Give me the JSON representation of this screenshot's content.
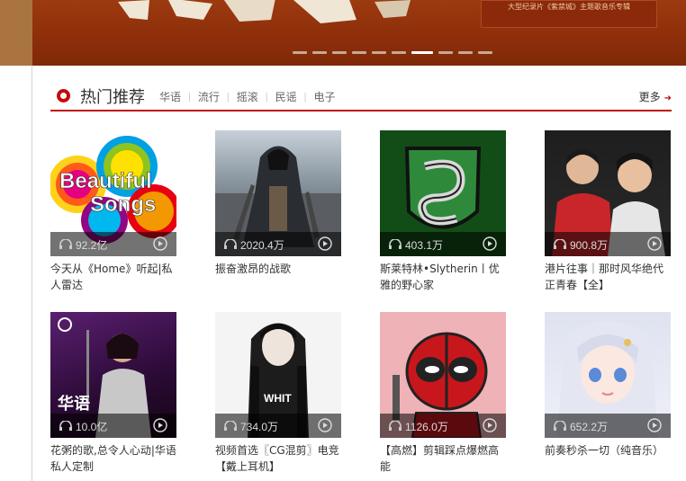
{
  "banner": {
    "tag_text": "大型纪录片《紫禁城》主题歌音乐专辑",
    "slide_count": 10,
    "active_slide": 7
  },
  "section": {
    "title": "热门推荐",
    "tags": [
      "华语",
      "流行",
      "摇滚",
      "民谣",
      "电子"
    ],
    "more": "更多"
  },
  "playlists": [
    {
      "count": "92.2亿",
      "title": "今天从《Home》听起|私人雷达",
      "cover_text": "Beautiful Songs"
    },
    {
      "count": "2020.4万",
      "title": "振奋激昂的战歌",
      "cover_text": ""
    },
    {
      "count": "403.1万",
      "title": "斯莱特林•Slytherin丨优雅的野心家",
      "cover_text": ""
    },
    {
      "count": "900.8万",
      "title": "港片往事｜那时风华绝代正青春【全】",
      "cover_text": ""
    },
    {
      "count": "10.0亿",
      "title": "花粥的歌,总令人心动|华语私人定制",
      "cover_text": "华语"
    },
    {
      "count": "734.0万",
      "title": "视频首选〖CG混剪〗电竞【戴上耳机】",
      "cover_text": "WHIT"
    },
    {
      "count": "1126.0万",
      "title": "【高燃】剪辑踩点爆燃高能",
      "cover_text": ""
    },
    {
      "count": "652.2万",
      "title": "前奏秒杀一切（纯音乐）",
      "cover_text": ""
    }
  ],
  "colors": {
    "accent": "#c10d0c",
    "banner": "#8d2e0a"
  }
}
